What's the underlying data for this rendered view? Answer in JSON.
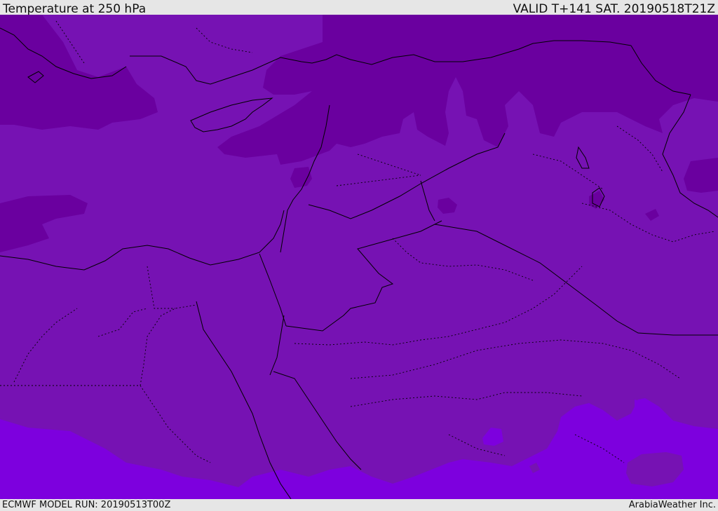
{
  "header": {
    "title": "Temperature at 250 hPa",
    "valid": "VALID T+141 SAT. 20190518T21Z"
  },
  "footer": {
    "model_run": "ECMWF MODEL RUN: 20190513T00Z",
    "credit": "ArabiaWeather Inc."
  },
  "map": {
    "colors": {
      "band_cold": "#6a009f",
      "band_mid": "#7612b3",
      "band_warm": "#7d00de",
      "coast": "#000000"
    }
  }
}
